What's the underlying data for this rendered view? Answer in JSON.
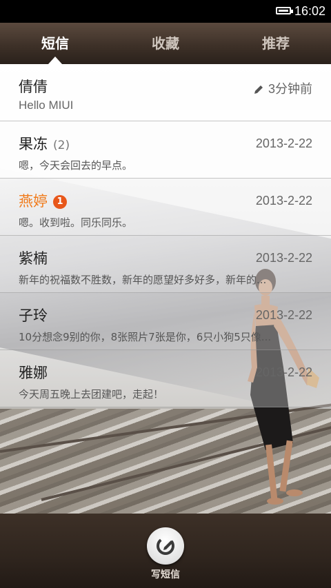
{
  "status_bar": {
    "time": "16:02",
    "battery_icon": "battery-full-icon"
  },
  "tabs": [
    {
      "label": "短信",
      "active": true
    },
    {
      "label": "收藏",
      "active": false
    },
    {
      "label": "推荐",
      "active": false
    }
  ],
  "conversations": [
    {
      "name": "倩倩",
      "count": "",
      "badge": "",
      "date": "3分钟前",
      "draft": true,
      "preview": "Hello MIUI",
      "unread": false
    },
    {
      "name": "果冻",
      "count": "(2)",
      "badge": "",
      "date": "2013-2-22",
      "draft": false,
      "preview": "嗯，今天会回去的早点。",
      "unread": false
    },
    {
      "name": "燕婷",
      "count": "",
      "badge": "1",
      "date": "2013-2-22",
      "draft": false,
      "preview": "嗯。收到啦。同乐同乐。",
      "unread": true
    },
    {
      "name": "紫楠",
      "count": "",
      "badge": "",
      "date": "2013-2-22",
      "draft": false,
      "preview": "新年的祝福数不胜数，新年的愿望好多好多，新年的...",
      "unread": false
    },
    {
      "name": "子玲",
      "count": "",
      "badge": "",
      "date": "2013-2-22",
      "draft": false,
      "preview": "10分想念9别的你，8张照片7张是你，6只小狗5只像...",
      "unread": false
    },
    {
      "name": "雅娜",
      "count": "",
      "badge": "",
      "date": "2013-2-22",
      "draft": false,
      "preview": "今天周五晚上去团建吧，走起！",
      "unread": false
    }
  ],
  "compose": {
    "label": "写短信",
    "icon": "compose-icon"
  },
  "colors": {
    "unread_name": "#f07a1a",
    "badge": "#e8571a",
    "header_bg": "#3e3128"
  }
}
